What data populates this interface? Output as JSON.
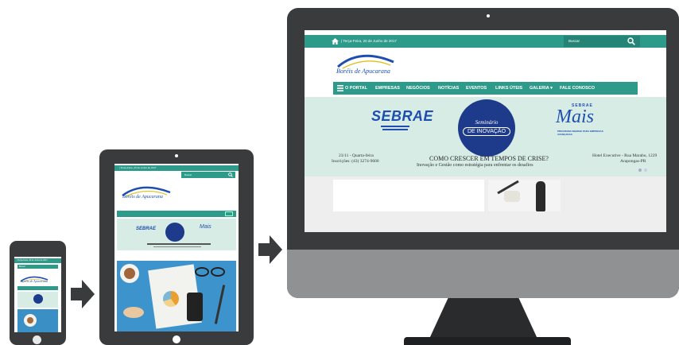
{
  "site": {
    "date_text": "| Terça-Feira, 20 de Junho de 2017",
    "search_placeholder": "Buscar",
    "logo_text": "Boréis de Apucarana",
    "nav": [
      "O PORTAL",
      "EMPRESAS",
      "NEGÓCIOS",
      "NOTÍCIAS",
      "EVENTOS",
      "LINKS ÚTEIS",
      "GALERIA ▾",
      "FALE CONOSCO"
    ]
  },
  "banner": {
    "sebrae": "SEBRAE",
    "seminar_line1": "Seminário",
    "seminar_line2": "DE INOVAÇÃO",
    "sebrae_mais_top": "SEBRAE",
    "sebrae_mais": "Mais",
    "sebrae_mais_sub": "PROGRAMA SEBRAE PARA EMPRESAS AVANÇADAS",
    "left_date": "23/11 - Quarta-feira",
    "left_inscr": "Inscrições: (43) 3274-9600",
    "headline": "COMO CRESCER EM TEMPOS DE CRISE?",
    "subheadline": "Inovação e Gestão como estratégia para enfrentar os desafios",
    "right_addr1": "Hotel Executive - Rua Marabu, 1229",
    "right_addr2": "Arapongas-PR"
  },
  "colors": {
    "teal": "#2e9a8a",
    "device": "#3a3b3d",
    "sebrae_blue": "#1e4fb0",
    "banner_bg": "#d8ece6"
  }
}
